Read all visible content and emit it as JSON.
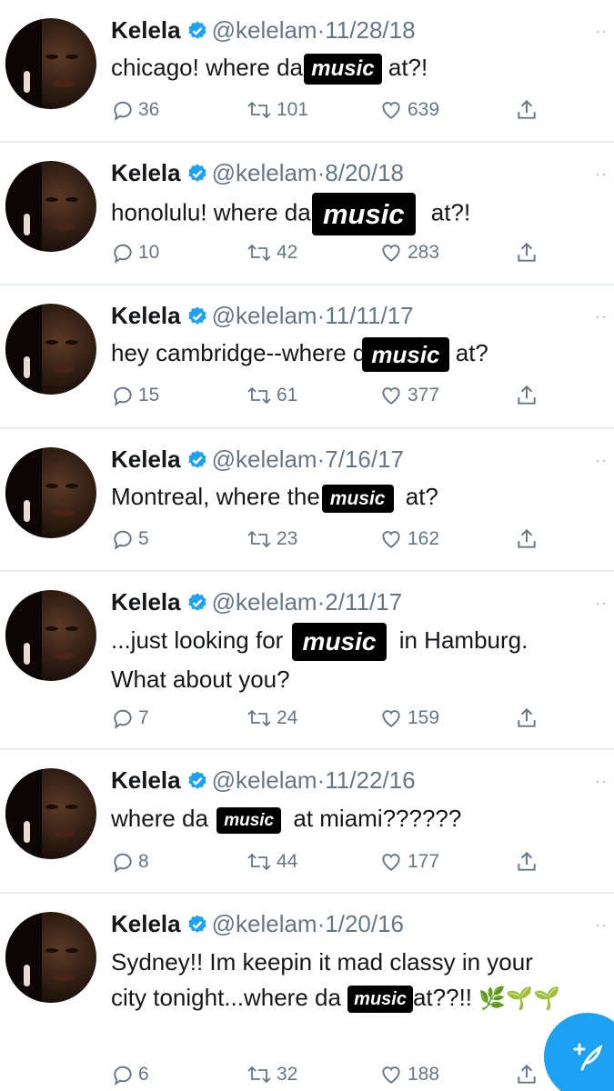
{
  "tweets": [
    {
      "name": "Kelela",
      "handle": "@kelelam",
      "date": "11/28/18",
      "pre": "chicago! where da",
      "badge": "music",
      "post": "at?!",
      "line2": "",
      "replies": "36",
      "retweets": "101",
      "likes": "639"
    },
    {
      "name": "Kelela",
      "handle": "@kelelam",
      "date": "8/20/18",
      "pre": "honolulu! where da",
      "badge": "music",
      "post": "at?!",
      "line2": "",
      "replies": "10",
      "retweets": "42",
      "likes": "283"
    },
    {
      "name": "Kelela",
      "handle": "@kelelam",
      "date": "11/11/17",
      "pre": "hey cambridge--where d",
      "badge": "music",
      "post": "at?",
      "line2": "",
      "replies": "15",
      "retweets": "61",
      "likes": "377"
    },
    {
      "name": "Kelela",
      "handle": "@kelelam",
      "date": "7/16/17",
      "pre": "Montreal, where the",
      "badge": "music",
      "post": "at?",
      "line2": "",
      "replies": "5",
      "retweets": "23",
      "likes": "162"
    },
    {
      "name": "Kelela",
      "handle": "@kelelam",
      "date": "2/11/17",
      "pre": "...just looking for",
      "badge": "music",
      "post": "in Hamburg.",
      "line2": "What about you?",
      "replies": "7",
      "retweets": "24",
      "likes": "159"
    },
    {
      "name": "Kelela",
      "handle": "@kelelam",
      "date": "11/22/16",
      "pre": "where da",
      "badge": "music",
      "post": "at miami??????",
      "line2": "",
      "replies": "8",
      "retweets": "44",
      "likes": "177"
    },
    {
      "name": "Kelela",
      "handle": "@kelelam",
      "date": "1/20/16",
      "line1": "Sydney!! Im keepin it mad classy in your",
      "pre": "city tonight...where da",
      "badge": "music",
      "post": "at??!!",
      "emoji": "🌿🌱🌱",
      "replies": "6",
      "retweets": "32",
      "likes": "188"
    }
  ],
  "sep": "·",
  "more": "··",
  "icons": {
    "verified": "verified-badge-icon",
    "reply": "reply-icon",
    "retweet": "retweet-icon",
    "like": "heart-icon",
    "share": "share-icon",
    "compose": "compose-tweet-icon"
  },
  "colors": {
    "accent": "#1da1f2",
    "muted": "#657786",
    "divider": "#e6ecf0"
  }
}
